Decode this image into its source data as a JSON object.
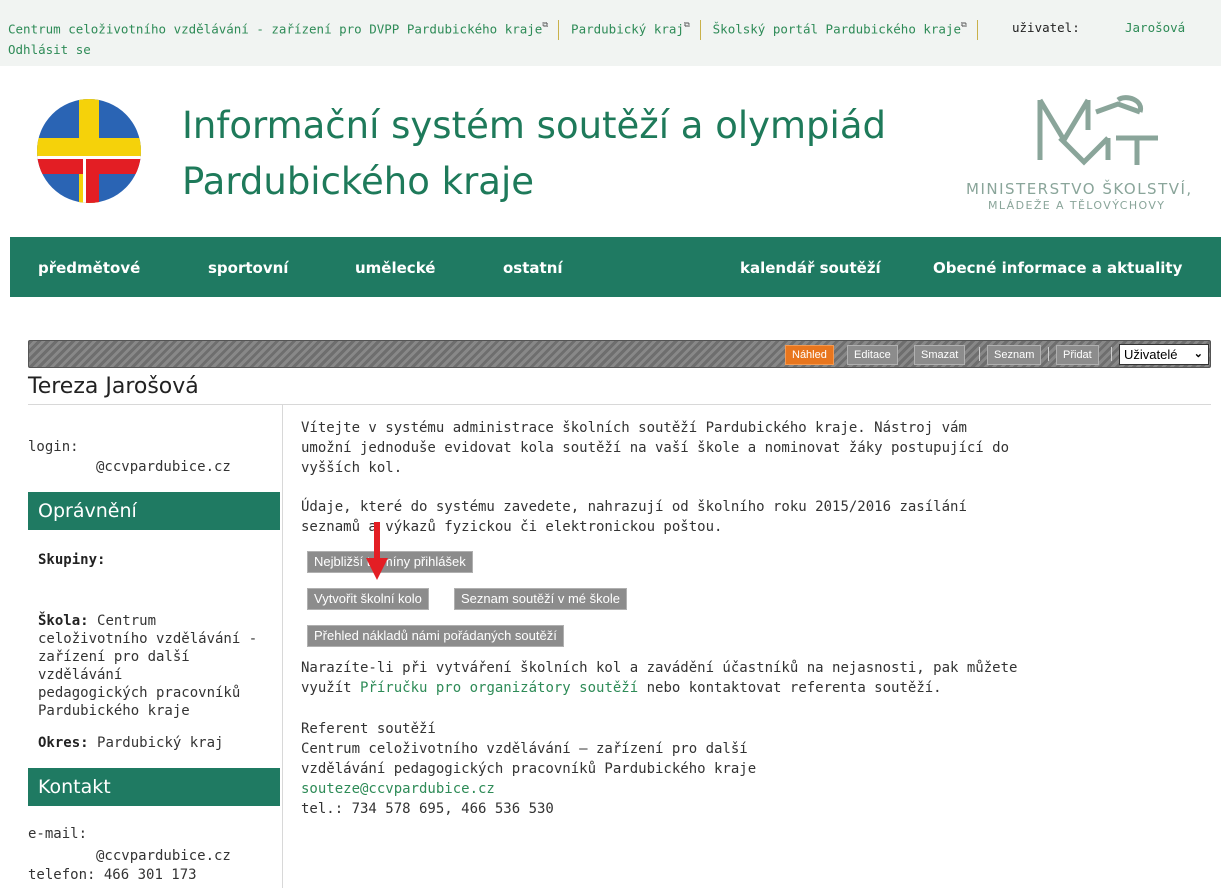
{
  "topbar": {
    "link1": "Centrum celoživotního vzdělávání - zařízení pro DVPP Pardubického kraje",
    "link2": "Pardubický kraj",
    "link3": "Školský portál Pardubického kraje",
    "external_icon": "external-link-icon",
    "user_label": "uživatel:",
    "user_name": "Jarošová",
    "logout": "Odhlásit se"
  },
  "header": {
    "title_line1": "Informační systém soutěží a olympiád",
    "title_line2": "Pardubického kraje",
    "logo_right_line1": "MINISTERSTVO ŠKOLSTVÍ,",
    "logo_right_line2": "MLÁDEŽE A TĚLOVÝCHOVY",
    "colors": {
      "green": "#1f7a62",
      "yellow": "#f5d20a",
      "blue": "#2a64b4",
      "red": "#e31e24"
    }
  },
  "nav": {
    "items": [
      "předmětové",
      "sportovní",
      "umělecké",
      "ostatní",
      "kalendář soutěží",
      "Obecné informace a aktuality"
    ]
  },
  "toolbar": {
    "buttons": [
      "Náhled",
      "Editace",
      "Smazat",
      "Seznam",
      "Přidat"
    ],
    "active": "Náhled",
    "select_value": "Uživatelé"
  },
  "person": {
    "name": "Tereza Jarošová"
  },
  "sidebar": {
    "login_label": "login:",
    "login_value": "@ccvpardubice.cz",
    "permissions_heading": "Oprávnění",
    "groups_label": "Skupiny:",
    "school_label": "Škola:",
    "school_value_l1": "Centrum",
    "school_value_l2": "celoživotního vzdělávání -",
    "school_value_l3": "zařízení pro další vzdělávání",
    "school_value_l4": "pedagogických pracovníků",
    "school_value_l5": "Pardubického kraje",
    "district_label": "Okres:",
    "district_value": "Pardubický kraj",
    "contact_heading": "Kontakt",
    "email_label": "e-mail:",
    "email_value": "@ccvpardubice.cz",
    "phone_label": "telefon:",
    "phone_value": "466 301 173"
  },
  "main": {
    "intro_l1": "Vítejte v systému administrace školních soutěží Pardubického kraje. Nástroj vám",
    "intro_l2": "umožní jednoduše evidovat kola soutěží na vaší škole a nominovat žáky postupující do",
    "intro_l3": "vyšších kol.",
    "info_l1": "Údaje, které do systému zavedete, nahrazují od školního roku 2015/2016 zasílání",
    "info_l2": "seznamů a výkazů fyzickou či elektronickou poštou.",
    "btn_deadlines": "Nejbližší termíny přihlášek",
    "btn_create_round": "Vytvořit školní kolo",
    "btn_school_list": "Seznam soutěží v mé škole",
    "btn_costs": "Přehled nákladů námi pořádaných soutěží",
    "help_l1": "Narazíte-li při vytváření školních kol a zavádění účastníků na nejasnosti, pak můžete",
    "help_pre": "využít ",
    "help_link": "Příručku pro organizátory soutěží",
    "help_post": " nebo kontaktovat referenta soutěží.",
    "ref_title": "Referent soutěží",
    "ref_l1": "Centrum celoživotního vzdělávání – zařízení pro další",
    "ref_l2": "vzdělávání pedagogických pracovníků Pardubického kraje",
    "ref_email": "souteze@ccvpardubice.cz",
    "ref_phone": "tel.: 734 578 695, 466 536 530"
  },
  "annotation": {
    "arrow_color": "#e31e24",
    "arrow_icon": "red-down-arrow"
  }
}
